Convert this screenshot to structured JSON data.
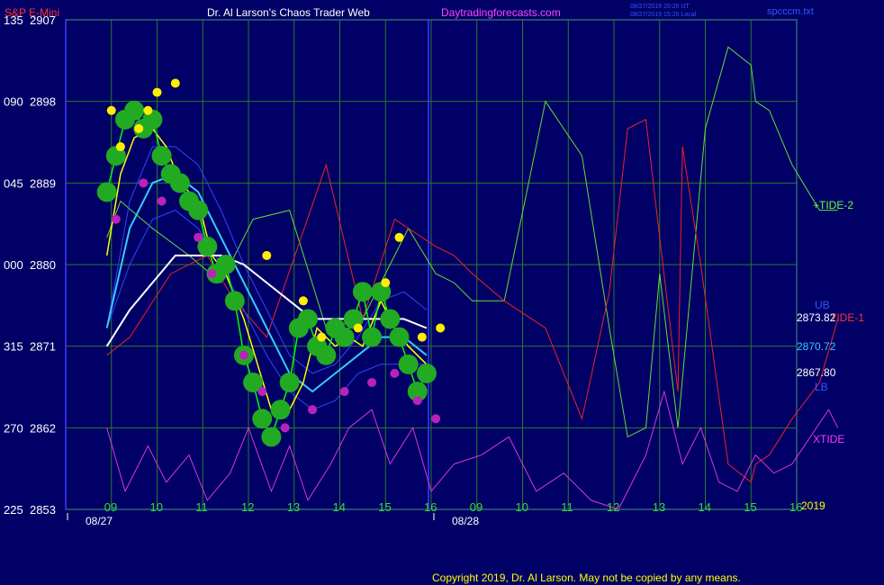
{
  "header": {
    "symbol": "S&P E-Mini",
    "title": "Dr. Al Larson's Chaos Trader Web",
    "site": "Daytradingforecasts.com",
    "timestamp_utc": "08/27/2019 20:20 UT",
    "timestamp_local": "08/27/2019 15:20 Local",
    "filename": "spcccm.txt"
  },
  "footer": {
    "copyright": "Copyright 2019, Dr. Al Larson. May not be copied by any means."
  },
  "colors": {
    "background": "#000066",
    "grid": "#2a7a2a",
    "frame": "#3a3aff",
    "tide2": "#66dd33",
    "tide1": "#ee2222",
    "xtide": "#dd33dd",
    "ub_lb": "#3344ff",
    "mid": "#33ccff",
    "slow_ma": "#ffffff",
    "fast_ma": "#ffff00",
    "price": "#00ff00",
    "highs": "#ffee00",
    "lows": "#bb22bb"
  },
  "chart_data": {
    "type": "line",
    "title": "S&P E-Mini",
    "y_ticks": [
      {
        "left": "135",
        "right": "2907",
        "value": 2907
      },
      {
        "left": "090",
        "right": "2898",
        "value": 2898
      },
      {
        "left": "045",
        "right": "2889",
        "value": 2889
      },
      {
        "left": "000",
        "right": "2880",
        "value": 2880
      },
      {
        "left": "315",
        "right": "2871",
        "value": 2871
      },
      {
        "left": "270",
        "right": "2862",
        "value": 2862
      },
      {
        "left": "225",
        "right": "2853",
        "value": 2853
      }
    ],
    "ylim": [
      2853,
      2907
    ],
    "x_hours": [
      "09",
      "10",
      "11",
      "12",
      "13",
      "14",
      "15",
      "16",
      "09",
      "10",
      "11",
      "12",
      "13",
      "14",
      "15",
      "16"
    ],
    "dates": [
      "08/27",
      "08/28"
    ],
    "year": "2019",
    "labels": {
      "tide2": "+TIDE-2",
      "tide1": "TIDE-1",
      "xtide": "XTIDE",
      "ub": "UB",
      "lb": "LB",
      "ub_value": "2873.82",
      "mid_value": "2870.72",
      "lb_value": "2867.80"
    },
    "series": [
      {
        "name": "+TIDE-2",
        "x": [
          0,
          0.3,
          1,
          1.8,
          2.5,
          3.2,
          4,
          4.8,
          5.6,
          6.6,
          7.2,
          7.6,
          8,
          8.7,
          9.6,
          10.4,
          11,
          11.4,
          11.8,
          12.1,
          12.5,
          13.1,
          13.6,
          14.1,
          14.2,
          14.5,
          15,
          15.6,
          16
        ],
        "y": [
          2883,
          2887,
          2884,
          2881,
          2878,
          2885,
          2886,
          2873,
          2874,
          2884,
          2879,
          2878,
          2876,
          2876,
          2898,
          2892,
          2873,
          2861,
          2862,
          2879,
          2862,
          2895,
          2904,
          2902,
          2898,
          2897,
          2891,
          2886,
          2886
        ]
      },
      {
        "name": "TIDE-1",
        "x": [
          0,
          0.5,
          1.4,
          2.2,
          2.8,
          3.5,
          4.8,
          5.6,
          6.3,
          7.2,
          7.6,
          8,
          8.7,
          9.6,
          10.4,
          11,
          11.4,
          11.8,
          12.1,
          12.5,
          12.6,
          13,
          13.6,
          14.1,
          14.2,
          14.5,
          15,
          15.6,
          16
        ],
        "y": [
          2870,
          2872,
          2879,
          2881,
          2876,
          2872,
          2891,
          2874,
          2885,
          2882,
          2881,
          2879,
          2876,
          2873,
          2863,
          2877,
          2895,
          2896,
          2883,
          2866,
          2893,
          2880,
          2858,
          2856,
          2858,
          2859,
          2863,
          2867,
          2874
        ]
      },
      {
        "name": "XTIDE",
        "x": [
          0,
          0.4,
          0.9,
          1.3,
          1.8,
          2.2,
          2.7,
          3.1,
          3.6,
          4,
          4.4,
          4.9,
          5.3,
          5.8,
          6.2,
          6.7,
          7.1,
          7.6,
          8.2,
          8.8,
          9.4,
          10,
          10.6,
          11.2,
          11.8,
          12.2,
          12.6,
          13,
          13.4,
          13.8,
          14.2,
          14.6,
          15,
          15.4,
          15.8,
          16
        ],
        "y": [
          2862,
          2855,
          2860,
          2856,
          2859,
          2854,
          2857,
          2862,
          2855,
          2860,
          2854,
          2858,
          2862,
          2864,
          2858,
          2862,
          2855,
          2858,
          2859,
          2861,
          2855,
          2857,
          2854,
          2853,
          2859,
          2866,
          2858,
          2862,
          2856,
          2855,
          2859,
          2857,
          2858,
          2861,
          2864,
          2862
        ]
      },
      {
        "name": "UB",
        "x": [
          0,
          0.5,
          1,
          1.5,
          2,
          2.5,
          3,
          3.5,
          4,
          4.5,
          5,
          5.5,
          6,
          6.5,
          7
        ],
        "y": [
          2873,
          2887,
          2893,
          2893,
          2891,
          2886,
          2880,
          2875,
          2870,
          2868,
          2869,
          2872,
          2876,
          2877,
          2875
        ]
      },
      {
        "name": "LB",
        "x": [
          0,
          0.5,
          1,
          1.5,
          2,
          2.5,
          3,
          3.5,
          4,
          4.5,
          5,
          5.5,
          6,
          6.5,
          7
        ],
        "y": [
          2873,
          2880,
          2885,
          2886,
          2884,
          2880,
          2875,
          2870,
          2866,
          2864,
          2865,
          2868,
          2869,
          2869,
          2869
        ]
      },
      {
        "name": "Mid",
        "x": [
          0,
          0.5,
          1,
          1.5,
          2,
          2.5,
          3,
          3.5,
          4,
          4.5,
          5,
          5.5,
          6,
          6.5,
          7
        ],
        "y": [
          2873,
          2884,
          2889,
          2890,
          2888,
          2883,
          2878,
          2873,
          2868,
          2866,
          2868,
          2870,
          2872,
          2872,
          2870
        ]
      },
      {
        "name": "Slow MA",
        "x": [
          0,
          0.5,
          1,
          1.5,
          2,
          2.5,
          3,
          3.5,
          4,
          4.5,
          5,
          5.5,
          6,
          6.5,
          7
        ],
        "y": [
          2871,
          2875,
          2878,
          2881,
          2881,
          2881,
          2880,
          2878,
          2876,
          2874,
          2874,
          2874,
          2874,
          2874,
          2873
        ]
      },
      {
        "name": "Fast MA",
        "x": [
          0,
          0.3,
          0.6,
          1,
          1.3,
          1.6,
          2,
          2.3,
          2.6,
          3,
          3.3,
          3.6,
          4,
          4.3,
          4.6,
          5,
          5.3,
          5.6,
          6,
          6.3,
          6.6,
          7
        ],
        "y": [
          2881,
          2890,
          2894,
          2895,
          2893,
          2889,
          2887,
          2881,
          2879,
          2874,
          2869,
          2864,
          2864,
          2867,
          2873,
          2871,
          2872,
          2871,
          2876,
          2873,
          2871,
          2869
        ]
      },
      {
        "name": "Price",
        "x": [
          0,
          0.2,
          0.4,
          0.6,
          0.8,
          1,
          1.2,
          1.4,
          1.6,
          1.8,
          2,
          2.2,
          2.4,
          2.6,
          2.8,
          3,
          3.2,
          3.4,
          3.6,
          3.8,
          4,
          4.2,
          4.4,
          4.6,
          4.8,
          5,
          5.2,
          5.4,
          5.6,
          5.8,
          6,
          6.2,
          6.4,
          6.6,
          6.8,
          7
        ],
        "y": [
          2888,
          2892,
          2896,
          2897,
          2895,
          2896,
          2892,
          2890,
          2889,
          2887,
          2886,
          2882,
          2879,
          2880,
          2876,
          2870,
          2867,
          2863,
          2861,
          2864,
          2867,
          2873,
          2874,
          2871,
          2870,
          2873,
          2872,
          2874,
          2877,
          2872,
          2877,
          2874,
          2872,
          2869,
          2866,
          2868
        ]
      }
    ],
    "highs": {
      "x": [
        0.1,
        0.3,
        0.7,
        0.9,
        1.1,
        1.5,
        3.5,
        4.3,
        4.7,
        5.5,
        6.1,
        6.4,
        6.9,
        7.3
      ],
      "y": [
        2897,
        2893,
        2895,
        2897,
        2899,
        2900,
        2881,
        2876,
        2872,
        2873,
        2878,
        2883,
        2872,
        2873
      ]
    },
    "lows": {
      "x": [
        0.2,
        0.8,
        1.2,
        2.0,
        2.3,
        3.0,
        3.4,
        3.9,
        4.5,
        5.2,
        5.8,
        6.3,
        6.8,
        7.2
      ],
      "y": [
        2885,
        2889,
        2887,
        2883,
        2879,
        2870,
        2866,
        2862,
        2864,
        2866,
        2867,
        2868,
        2865,
        2863
      ]
    },
    "grid": true
  }
}
